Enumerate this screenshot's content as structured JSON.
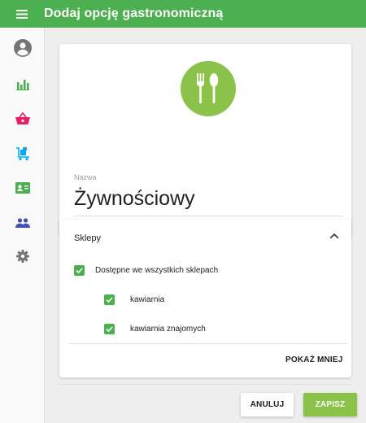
{
  "appbar": {
    "title": "Dodaj opcję gastronomiczną",
    "menu_icon": "menu-icon",
    "color": "#4caf50"
  },
  "sidebar": {
    "items": [
      {
        "icon": "account-circle-icon",
        "color": "#757575"
      },
      {
        "icon": "bar-chart-icon",
        "color": "#4caf50"
      },
      {
        "icon": "shopping-basket-icon",
        "color": "#e91e63"
      },
      {
        "icon": "luggage-cart-icon",
        "color": "#03a9f4"
      },
      {
        "icon": "contact-card-icon",
        "color": "#4caf50"
      },
      {
        "icon": "people-icon",
        "color": "#3f51b5"
      },
      {
        "icon": "settings-icon",
        "color": "#757575"
      }
    ]
  },
  "option": {
    "icon": "food-cutlery-icon",
    "icon_bg": "#8bc34a",
    "name_label": "Nazwa",
    "name_value": "Żywnościowy"
  },
  "shops": {
    "title": "Sklepy",
    "expanded": true,
    "all_shops_label": "Dostępne we wszystkich sklepach",
    "all_shops_checked": true,
    "items": [
      {
        "label": "kawiarnia",
        "checked": true
      },
      {
        "label": "kawiarnia znajomych",
        "checked": true
      }
    ],
    "show_less_label": "POKAŻ MNIEJ"
  },
  "actions": {
    "cancel_label": "ANULUJ",
    "save_label": "ZAPISZ",
    "save_color": "#8bc34a"
  }
}
